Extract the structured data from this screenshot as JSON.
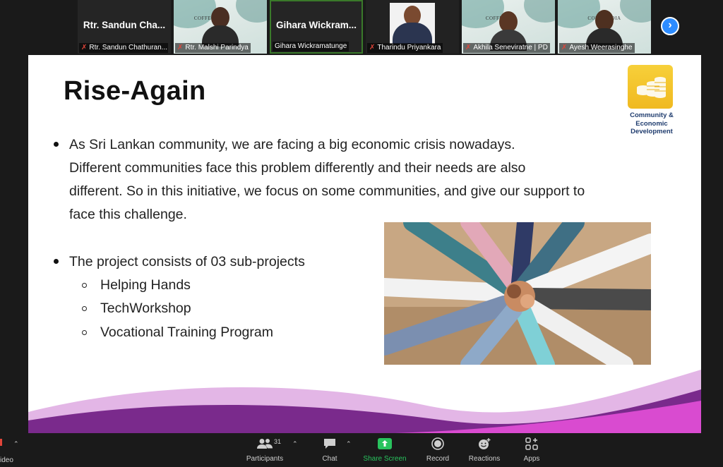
{
  "participants": [
    {
      "display_name": "Rtr. Sandun Cha...",
      "label": "Rtr. Sandun Chathuran...",
      "muted": true,
      "video": false
    },
    {
      "display_name": "",
      "label": "Rtr. Malshi Parindya",
      "muted": true,
      "video": true,
      "background_text": "COFFE"
    },
    {
      "display_name": "Gihara  Wickram...",
      "label": "Gihara Wickramatunge",
      "muted": false,
      "video": false
    },
    {
      "display_name": "",
      "label": "Tharindu Priyankara",
      "muted": true,
      "video": true
    },
    {
      "display_name": "",
      "label": "Akhila Seneviratne | PD",
      "muted": true,
      "video": true,
      "background_text": "COFFE"
    },
    {
      "display_name": "",
      "label": "Ayesh Weerasinghe",
      "muted": true,
      "video": true,
      "background_text": "COFFE   MOIA"
    }
  ],
  "slide": {
    "title": "Rise-Again",
    "logo_caption": [
      "Community &",
      "Economic",
      "Development"
    ],
    "bullet1_lines": [
      "As Sri Lankan community, we are facing a big economic crisis nowadays.",
      "Different communities face this problem differently and their needs are also",
      "different. So in this initiative, we focus on some communities, and give our support to",
      "face this challenge."
    ],
    "bullet2": "The project consists of 03 sub-projects",
    "sub_projects": [
      "Helping Hands",
      "TechWorkshop",
      "Vocational Training Program"
    ]
  },
  "toolbar": {
    "video_label": "ideo",
    "participants_label": "Participants",
    "participants_count": "31",
    "chat_label": "Chat",
    "share_label": "Share Screen",
    "record_label": "Record",
    "reactions_label": "Reactions",
    "apps_label": "Apps"
  },
  "colors": {
    "share_green": "#29c35e",
    "mute_red": "#e0453a",
    "next_blue": "#2d8cff",
    "logo_yellow": "#f5c62e",
    "wave_purple": "#7a2a8c",
    "wave_magenta": "#d94bd0"
  }
}
